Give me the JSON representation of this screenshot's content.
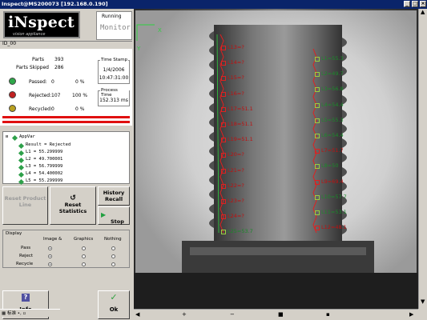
{
  "window": {
    "title": "Inspect@MS200073 [192.168.0.190]"
  },
  "logo": {
    "text": "iNspect",
    "tagline": "vision appliance"
  },
  "status": {
    "running": "Running",
    "mode": "Monitor"
  },
  "device": {
    "id": "ID_00"
  },
  "stats": {
    "parts_label": "Parts",
    "parts_value": "393",
    "skipped_label": "Parts Skipped",
    "skipped_value": "286",
    "passed_label": "Passed:",
    "passed_value": "0",
    "passed_pct": "0 %",
    "rejected_label": "Rejected:",
    "rejected_value": "107",
    "rejected_pct": "100 %",
    "recycled_label": "Recycled:",
    "recycled_value": "0",
    "recycled_pct": "0 %",
    "timestamp_label": "Time Stamp",
    "timestamp_date": "1/4/2006",
    "timestamp_time": "10:47:31:00",
    "process_label": "Process Time",
    "process_value": "152.313 ms",
    "colors": {
      "passed": "#2fa84a",
      "rejected": "#c02020",
      "recycled": "#b8a020"
    }
  },
  "tree": {
    "root": "AppVar",
    "items": [
      "Result = Rejected",
      "L1 = 55.299999",
      "L2 = 49.700001",
      "L3 = 56.799999",
      "L4 = 54.400002",
      "L5 = 55.299999"
    ]
  },
  "buttons": {
    "reset_product": "Reset Product Line",
    "reset_stats": "Reset Statistics",
    "history": "History Recall",
    "stop": "Stop",
    "info": "Info",
    "ok": "Ok"
  },
  "display": {
    "title": "Display",
    "col1": "Image &",
    "col2": "Graphics",
    "col3": "Nothing",
    "rows": [
      "Pass",
      "Reject",
      "Recycle"
    ]
  },
  "taskbar": {
    "text": "标准"
  },
  "image": {
    "origin_x": "X",
    "origin_y": "Y",
    "left_labels": [
      "L13=?",
      "L14=?",
      "L15=?",
      "L16=?",
      "L17=51.1",
      "L18=51.1",
      "L19=51.1",
      "L20=?",
      "L21=?",
      "L22=?",
      "L23=?",
      "L24=?",
      "L25=53.7"
    ],
    "right_labels": [
      "L1=55.3",
      "L2=49.7",
      "L3=56.8",
      "L4=54.4",
      "L5=55.3",
      "L6=54.4",
      "L7=51.7",
      "L8=50",
      "L9=69.4",
      "L10=57.7",
      "L11=53.1",
      "L12=48.1"
    ]
  }
}
